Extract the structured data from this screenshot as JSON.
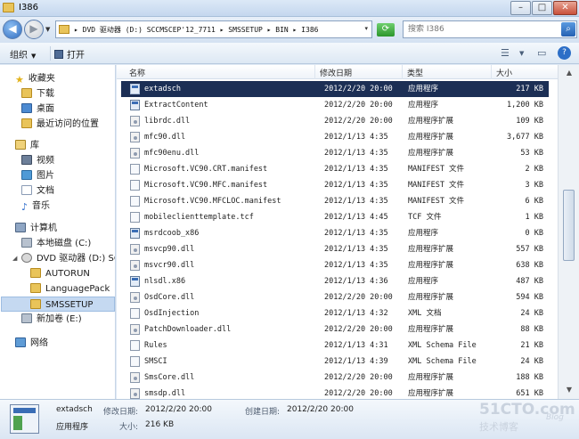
{
  "window": {
    "title": "I386",
    "min": "–",
    "max": "□",
    "close": "✕"
  },
  "address": {
    "path": "▸ DVD 驱动器 (D:) SCCMSCEP'12_7711 ▸ SMSSETUP ▸ BIN ▸ I386",
    "dropdown": "▾",
    "refresh": "⟳",
    "search_placeholder": "搜索 I386",
    "search_icon": "search-icon"
  },
  "toolbar": {
    "organize": "组织",
    "open": "打开",
    "views": "☰",
    "preview": "▭",
    "help": "?"
  },
  "nav": {
    "favorites": "收藏夹",
    "downloads": "下载",
    "desktop": "桌面",
    "recent": "最近访问的位置",
    "libraries": "库",
    "videos": "视频",
    "pictures": "图片",
    "documents": "文档",
    "music": "音乐",
    "computer": "计算机",
    "local_disk": "本地磁盘 (C:)",
    "dvd_drive": "DVD 驱动器 (D:) SC",
    "autorun": "AUTORUN",
    "languagepack": "LanguagePack",
    "smssetup": "SMSSETUP",
    "new_volume": "新加卷 (E:)",
    "network": "网络"
  },
  "columns": {
    "name": "名称",
    "date": "修改日期",
    "type": "类型",
    "size": "大小"
  },
  "files": [
    {
      "name": "extadsch",
      "date": "2012/2/20 20:00",
      "type": "应用程序",
      "size": "217 KB",
      "icon": "exe",
      "selected": true
    },
    {
      "name": "ExtractContent",
      "date": "2012/2/20 20:00",
      "type": "应用程序",
      "size": "1,200 KB",
      "icon": "exe"
    },
    {
      "name": "librdc.dll",
      "date": "2012/2/20 20:00",
      "type": "应用程序扩展",
      "size": "109 KB",
      "icon": "dll"
    },
    {
      "name": "mfc90.dll",
      "date": "2012/1/13 4:35",
      "type": "应用程序扩展",
      "size": "3,677 KB",
      "icon": "dll"
    },
    {
      "name": "mfc90enu.dll",
      "date": "2012/1/13 4:35",
      "type": "应用程序扩展",
      "size": "53 KB",
      "icon": "dll"
    },
    {
      "name": "Microsoft.VC90.CRT.manifest",
      "date": "2012/1/13 4:35",
      "type": "MANIFEST 文件",
      "size": "2 KB",
      "icon": "file"
    },
    {
      "name": "Microsoft.VC90.MFC.manifest",
      "date": "2012/1/13 4:35",
      "type": "MANIFEST 文件",
      "size": "3 KB",
      "icon": "file"
    },
    {
      "name": "Microsoft.VC90.MFCLOC.manifest",
      "date": "2012/1/13 4:35",
      "type": "MANIFEST 文件",
      "size": "6 KB",
      "icon": "file"
    },
    {
      "name": "mobileclienttemplate.tcf",
      "date": "2012/1/13 4:45",
      "type": "TCF 文件",
      "size": "1 KB",
      "icon": "file"
    },
    {
      "name": "msrdcoob_x86",
      "date": "2012/1/13 4:35",
      "type": "应用程序",
      "size": "0 KB",
      "icon": "exe"
    },
    {
      "name": "msvcp90.dll",
      "date": "2012/1/13 4:35",
      "type": "应用程序扩展",
      "size": "557 KB",
      "icon": "dll"
    },
    {
      "name": "msvcr90.dll",
      "date": "2012/1/13 4:35",
      "type": "应用程序扩展",
      "size": "638 KB",
      "icon": "dll"
    },
    {
      "name": "nlsdl.x86",
      "date": "2012/1/13 4:36",
      "type": "应用程序",
      "size": "487 KB",
      "icon": "exe"
    },
    {
      "name": "OsdCore.dll",
      "date": "2012/2/20 20:00",
      "type": "应用程序扩展",
      "size": "594 KB",
      "icon": "dll"
    },
    {
      "name": "OsdInjection",
      "date": "2012/1/13 4:32",
      "type": "XML 文档",
      "size": "24 KB",
      "icon": "file"
    },
    {
      "name": "PatchDownloader.dll",
      "date": "2012/2/20 20:00",
      "type": "应用程序扩展",
      "size": "88 KB",
      "icon": "dll"
    },
    {
      "name": "Rules",
      "date": "2012/1/13 4:31",
      "type": "XML Schema File",
      "size": "21 KB",
      "icon": "file"
    },
    {
      "name": "SMSCI",
      "date": "2012/1/13 4:39",
      "type": "XML Schema File",
      "size": "24 KB",
      "icon": "file"
    },
    {
      "name": "SmsCore.dll",
      "date": "2012/2/20 20:00",
      "type": "应用程序扩展",
      "size": "188 KB",
      "icon": "dll"
    },
    {
      "name": "smsdp.dll",
      "date": "2012/2/20 20:00",
      "type": "应用程序扩展",
      "size": "651 KB",
      "icon": "dll"
    }
  ],
  "details": {
    "name": "extadsch",
    "modified_label": "修改日期:",
    "modified": "2012/2/20 20:00",
    "created_label": "创建日期:",
    "created": "2012/2/20 20:00",
    "type": "应用程序",
    "size_label": "大小:",
    "size": "216 KB"
  },
  "watermark": {
    "site": "51CTO.com",
    "sub": "技术博客",
    "blog": "Blog"
  }
}
